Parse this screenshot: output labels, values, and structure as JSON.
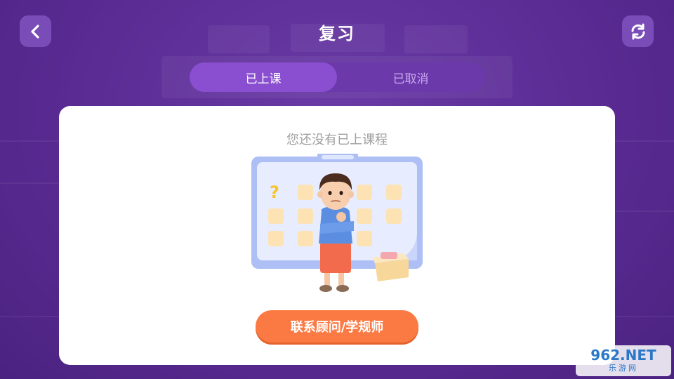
{
  "header": {
    "title": "复习",
    "back_icon": "chevron-left-icon",
    "refresh_icon": "refresh-icon"
  },
  "tabs": [
    {
      "label": "已上课",
      "active": true
    },
    {
      "label": "已取消",
      "active": false
    }
  ],
  "empty_state": {
    "message": "您还没有已上课程",
    "illustration": "confused-boy-calendar-illustration"
  },
  "contact_button": {
    "label": "联系顾问/学规师"
  },
  "watermark": {
    "top": "962.NET",
    "bottom": "乐游网"
  },
  "colors": {
    "background": "#5a2b93",
    "tab_active": "#8a4fd0",
    "button": "#fb7a44",
    "card": "#ffffff"
  }
}
